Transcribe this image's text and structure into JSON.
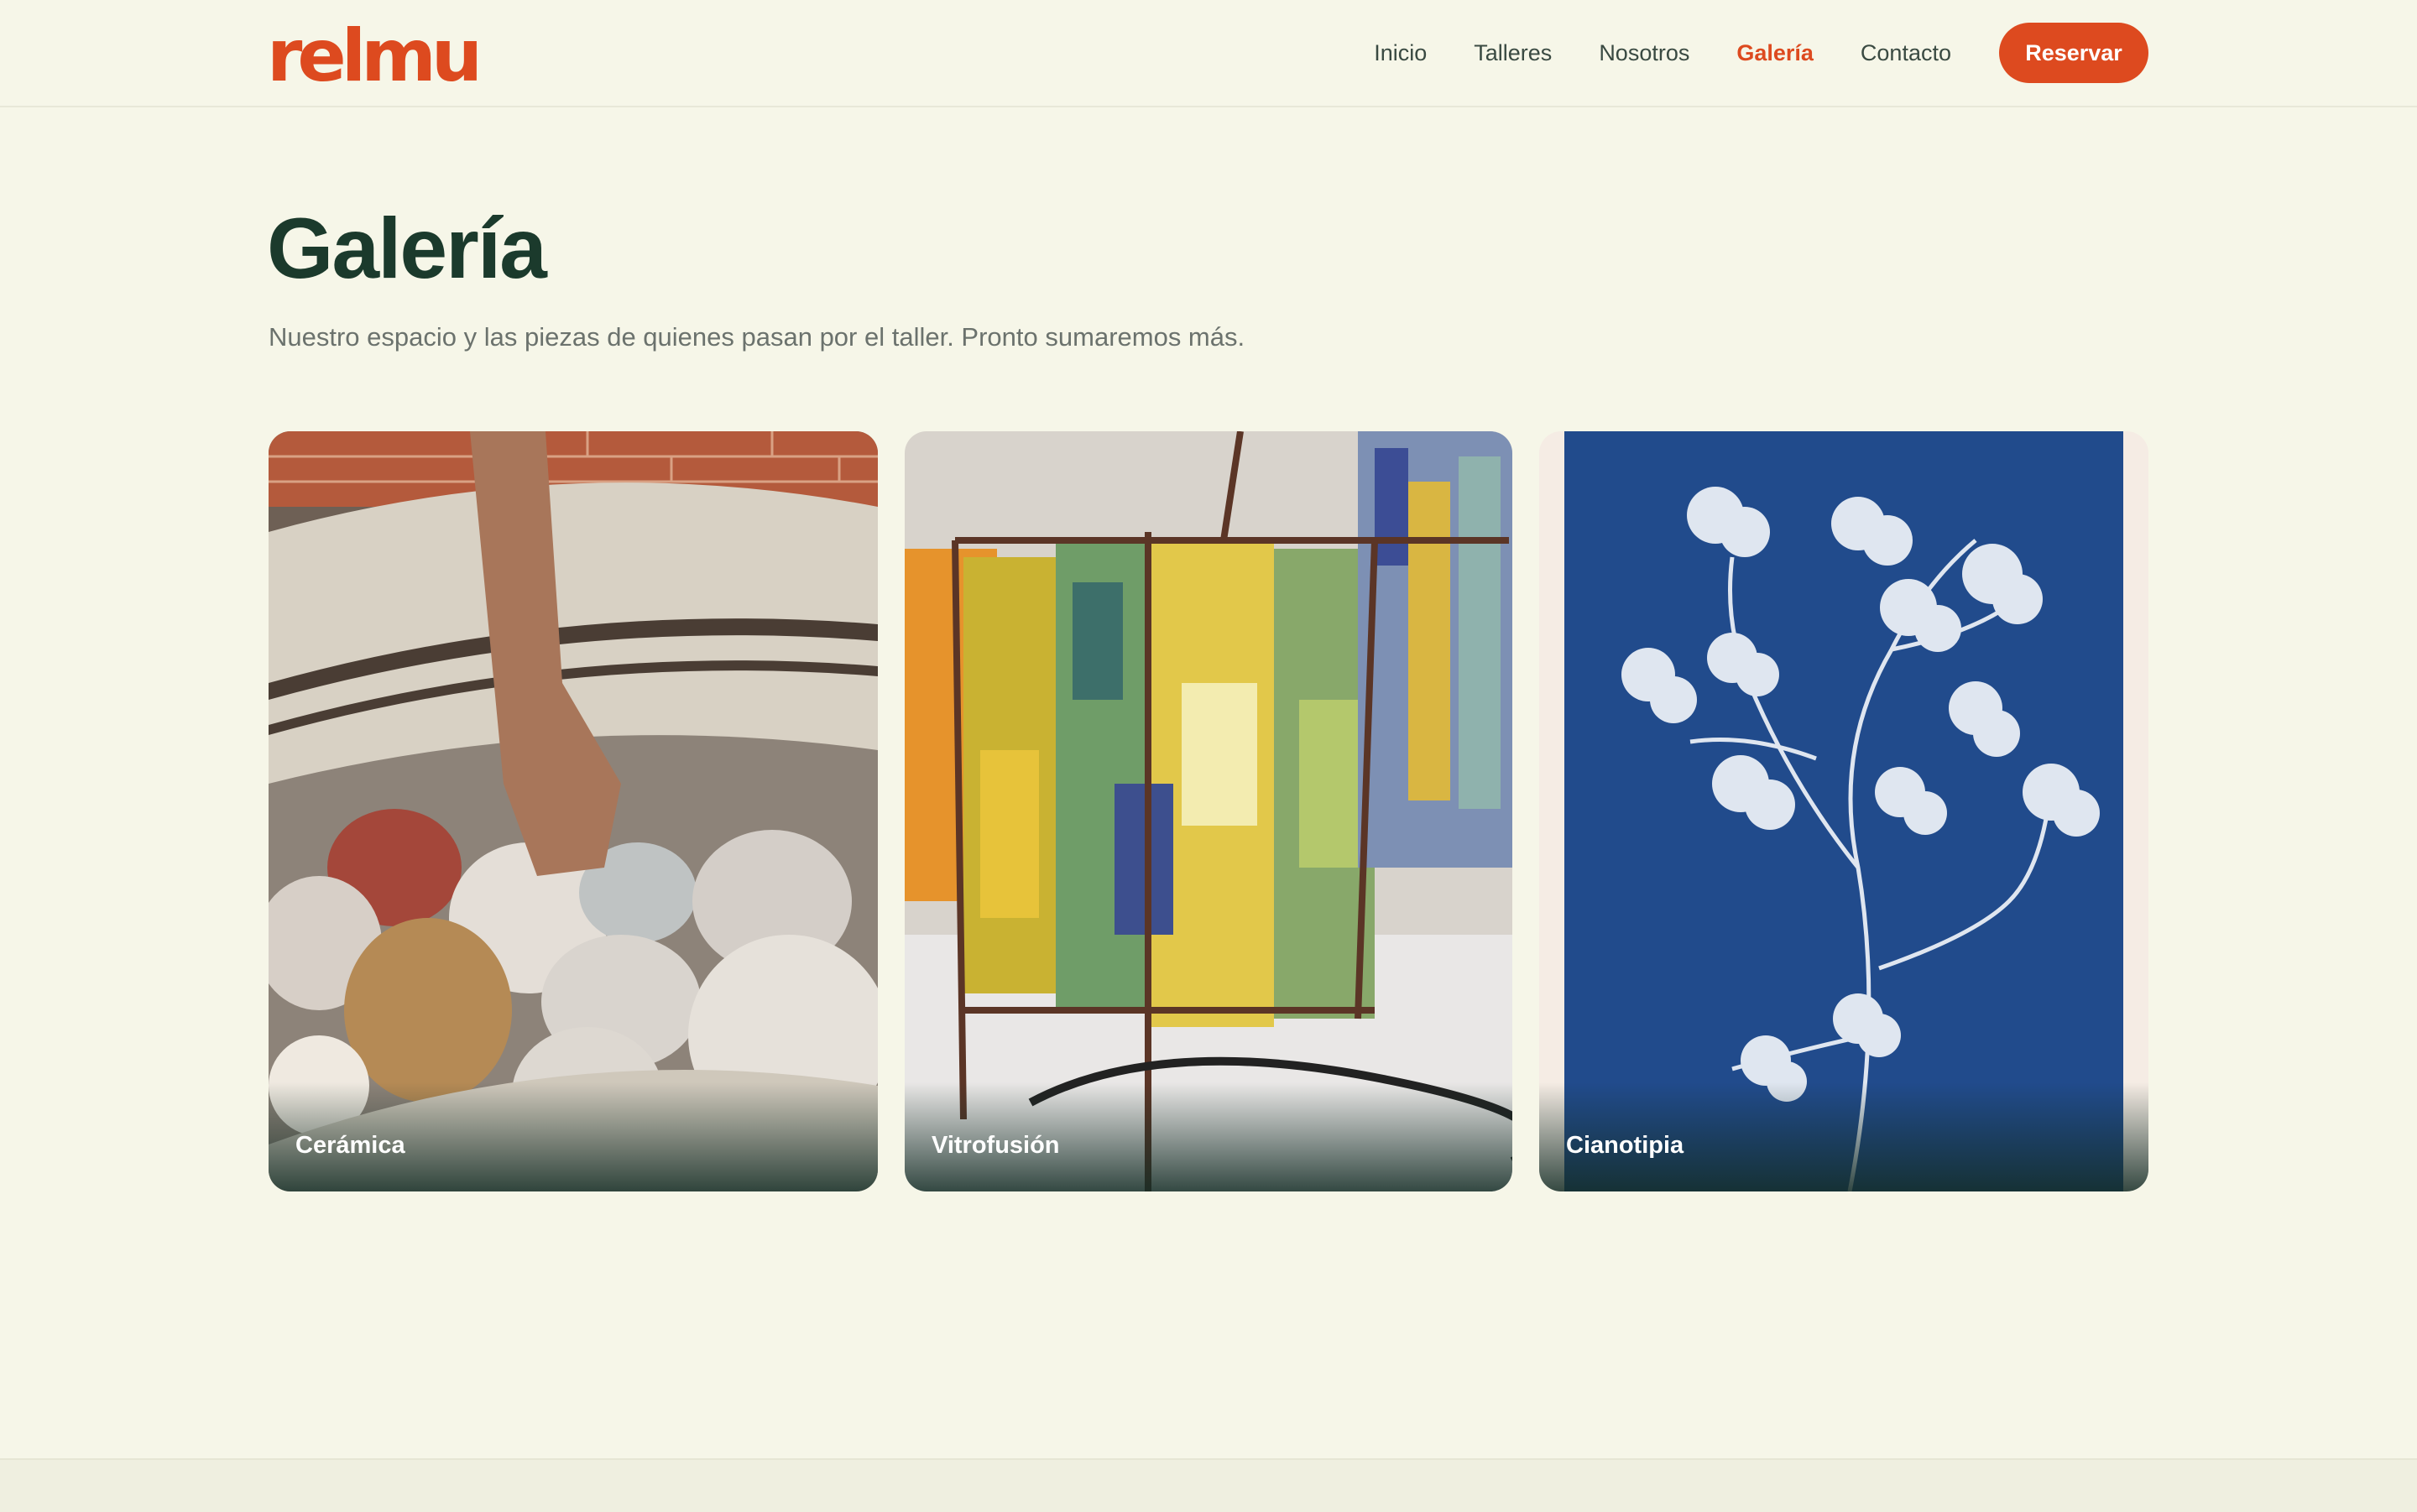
{
  "brand": {
    "logo_text": "relmu",
    "accent_color": "#dd4a1f"
  },
  "nav": {
    "links": [
      {
        "label": "Inicio",
        "active": false
      },
      {
        "label": "Talleres",
        "active": false
      },
      {
        "label": "Nosotros",
        "active": false
      },
      {
        "label": "Galería",
        "active": true
      },
      {
        "label": "Contacto",
        "active": false
      }
    ],
    "cta_label": "Reservar"
  },
  "page": {
    "title": "Galería",
    "subtitle": "Nuestro espacio y las piezas de quienes pasan por el taller. Pronto sumaremos más."
  },
  "gallery": {
    "items": [
      {
        "caption": "Cerámica",
        "image": "ceramic-mugs-in-kiln"
      },
      {
        "caption": "Vitrofusión",
        "image": "fused-glass-lamps"
      },
      {
        "caption": "Cianotipia",
        "image": "cyanotype-clover-print"
      }
    ]
  }
}
